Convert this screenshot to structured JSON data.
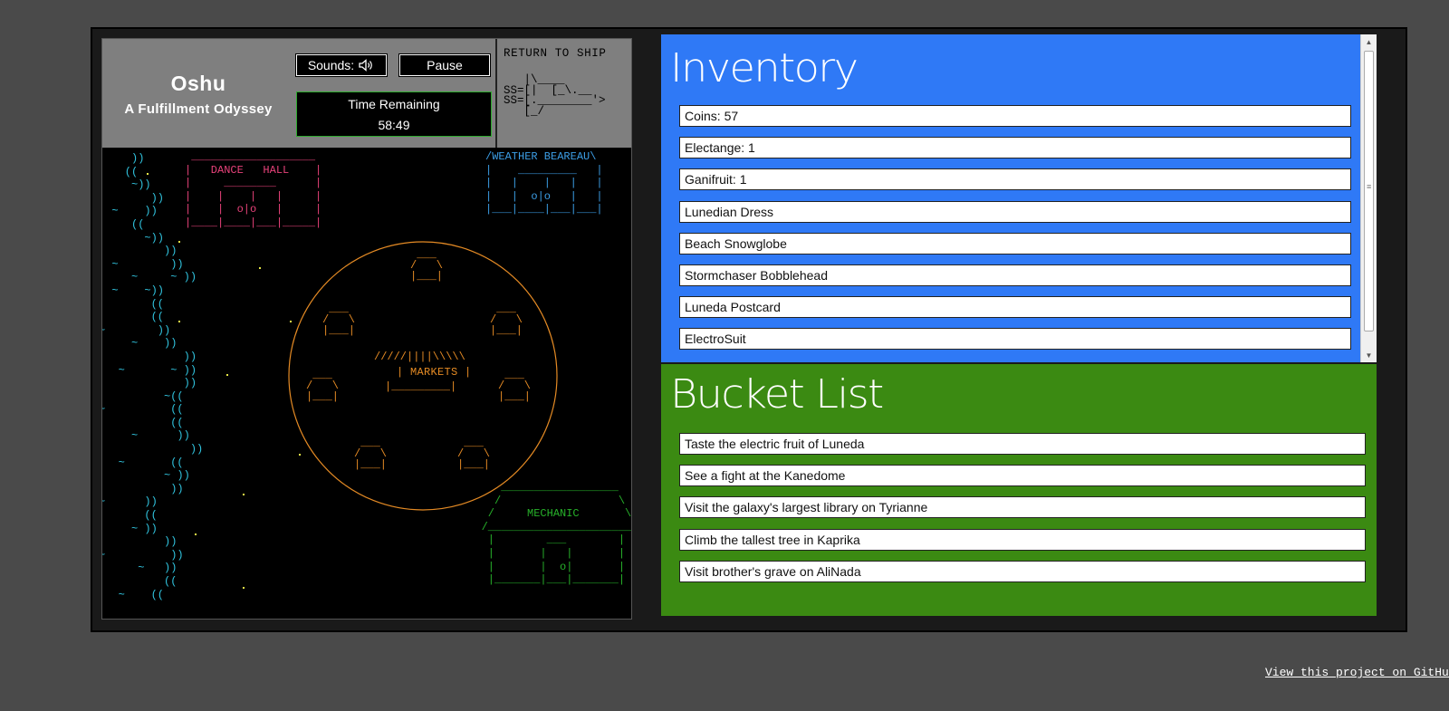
{
  "hud": {
    "title": "Oshu",
    "subtitle": "A Fulfillment Odyssey",
    "sounds_label": "Sounds:",
    "sounds_icon": "speaker-icon",
    "pause_label": "Pause",
    "timer_label": "Time Remaining",
    "timer_value": "58:49",
    "return_label": "RETURN TO SHIP",
    "ship_art": "   |\\____\nSS=[|  [_\\.__\nSS=[.________'>\n   [_/"
  },
  "world": {
    "dance_hall": " ___________________\n|   DANCE   HALL    |\n|     ________      |\n|    |    |   |     |\n|    |  o|o   |     |\n|____|____|___|_____|",
    "weather": "/WEATHER BEAREAU\\\n|    _________   |\n|   |    |   |   |\n|   |  o|o   |   |\n|___|____|___|___|",
    "markets": "| MARKETS |",
    "mechanic": "      __________________\n     /                  \\\n    /     MECHANIC       \\\n   /______________________\\\n    |        ___        |\n    |       |   |       |\n    |       |  o|       |\n    |_______|___|_______|",
    "stall_art": " ___\n/   \\\n|___|"
  },
  "colors": {
    "background": "#4a4a4a",
    "inventory_bg": "#2f79f6",
    "bucket_bg": "#3b8a12",
    "river": "#31c5e0",
    "dance_hall": "#e8427a",
    "weather": "#3c9ee6",
    "markets": "#e48a24",
    "mechanic": "#27b22a",
    "timer_border": "#2eaa2e"
  },
  "inventory": {
    "heading": "Inventory",
    "items": [
      "Coins: 57",
      "Electange: 1",
      "Ganifruit: 1",
      "Lunedian Dress",
      "Beach Snowglobe",
      "Stormchaser Bobblehead",
      "Luneda Postcard",
      "ElectroSuit"
    ]
  },
  "bucket_list": {
    "heading": "Bucket List",
    "items": [
      "Taste the electric fruit of Luneda",
      "See a fight at the Kanedome",
      "Visit the galaxy's largest library on Tyrianne",
      "Climb the tallest tree in Kaprika",
      "Visit brother's grave on AliNada"
    ]
  },
  "footer": {
    "github_link": "View this project on GitHub"
  }
}
